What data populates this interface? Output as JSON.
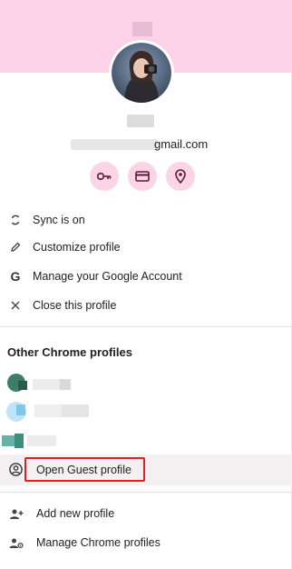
{
  "colors": {
    "header_band": "#fcd2e8",
    "quick_action_bg": "#fbd4e6",
    "quick_action_icon": "#5a1a33",
    "highlight_border": "#e02020",
    "guest_row_bg": "#f2f0f1"
  },
  "account": {
    "email_suffix": "gmail.com"
  },
  "quick_actions": [
    {
      "name": "passwords",
      "icon": "key-icon"
    },
    {
      "name": "payment-methods",
      "icon": "credit-card-icon"
    },
    {
      "name": "addresses",
      "icon": "location-pin-icon"
    }
  ],
  "menu": {
    "sync": "Sync is on",
    "customize": "Customize profile",
    "manage_google": "Manage your Google Account",
    "close_profile": "Close this profile"
  },
  "other_profiles": {
    "title": "Other Chrome profiles"
  },
  "guest": {
    "label": "Open Guest profile"
  },
  "footer": {
    "add_profile": "Add new profile",
    "manage_profiles": "Manage Chrome profiles"
  }
}
